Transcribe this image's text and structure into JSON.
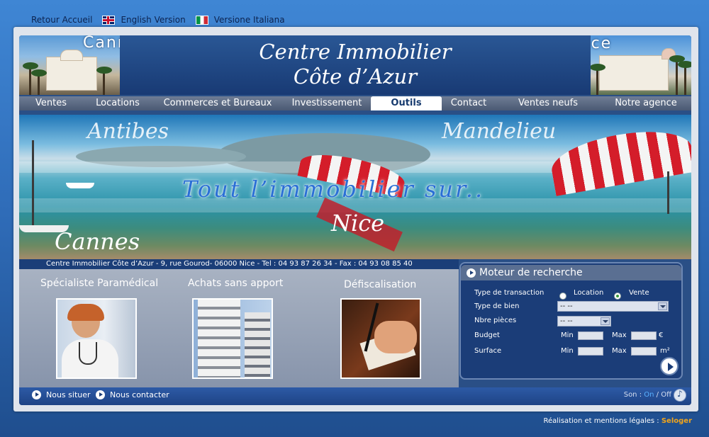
{
  "topbar": {
    "home": "Retour Accueil",
    "english": "English Version",
    "italian": "Versione Italiana"
  },
  "header": {
    "title_line1": "Centre Immobilier",
    "title_line2": "Côte d’Azur",
    "city_left": "Cannes",
    "city_right": "Nice"
  },
  "nav": {
    "items": [
      "Ventes",
      "Locations",
      "Commerces et Bureaux",
      "Investissement",
      "Outils",
      "Contact",
      "Ventes neufs",
      "Notre agence"
    ],
    "active": "Outils"
  },
  "banner": {
    "tagline": "Tout l’immobilier sur..",
    "cities": [
      "Antibes",
      "Mandelieu",
      "Nice",
      "Cannes"
    ]
  },
  "address": "Centre Immobilier Côte d’Azur - 9, rue Gourod- 06000 Nice - Tel : 04 93 87 26 34 - Fax : 04 93 08 85 40",
  "features": [
    {
      "title": "Spécialiste Paramédical"
    },
    {
      "title": "Achats sans apport"
    },
    {
      "title": "Défiscalisation"
    }
  ],
  "search": {
    "title": "Moteur de recherche",
    "transaction_label": "Type de transaction",
    "option_location": "Location",
    "option_vente": "Vente",
    "selected_transaction": "Vente",
    "type_bien_label": "Type de bien",
    "type_bien_value": "-- --",
    "pieces_label": "Nbre pièces",
    "pieces_value": "-- --",
    "budget_label": "Budget",
    "surface_label": "Surface",
    "min_label": "Min",
    "max_label": "Max",
    "budget_unit": "€",
    "surface_unit": "m²"
  },
  "footer": {
    "situer": "Nous situer",
    "contacter": "Nous contacter",
    "son_label": "Son :",
    "on": "On",
    "separator": "/",
    "off": "Off"
  },
  "credit": {
    "text": "Réalisation et mentions légales :",
    "link": "Seloger"
  },
  "colors": {
    "panel": "#2a4f86",
    "nav": "#5a6880",
    "accent_link": "#f1a51b",
    "search_bg": "#1b3d78"
  }
}
